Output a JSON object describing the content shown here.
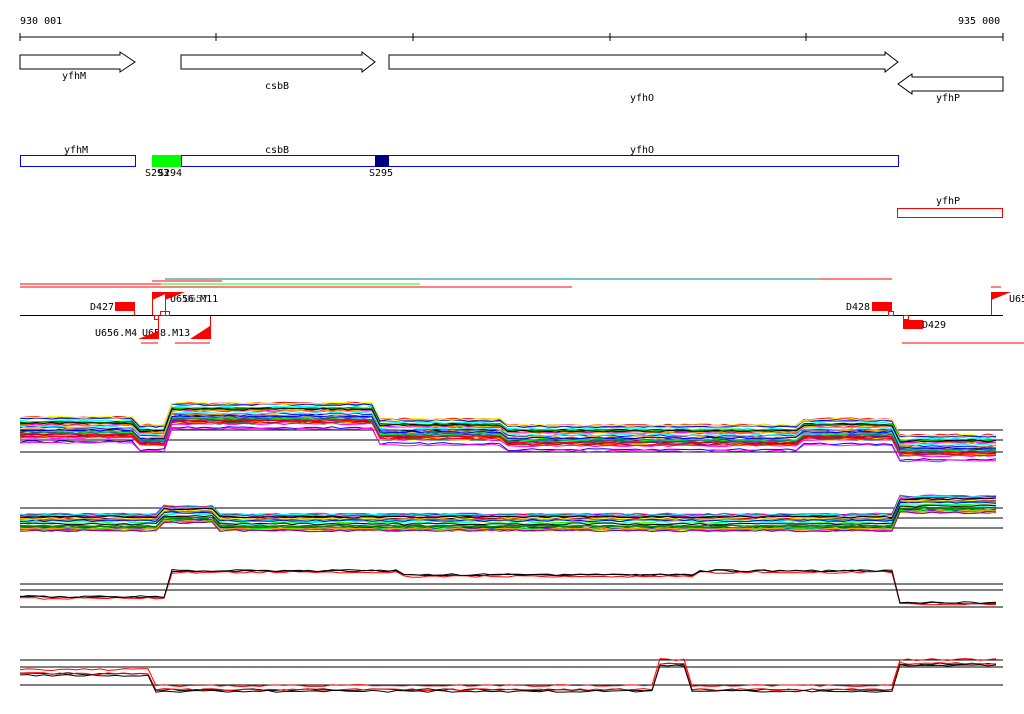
{
  "axis": {
    "start_label": "930 001",
    "end_label": "935 000"
  },
  "genes": [
    {
      "name": "yfhM",
      "strand": "+"
    },
    {
      "name": "csbB",
      "strand": "+"
    },
    {
      "name": "yfhO",
      "strand": "+"
    },
    {
      "name": "yfhP",
      "strand": "-"
    }
  ],
  "operons": {
    "yfhM": "yfhM",
    "csbB": "csbB",
    "yfhO": "yfhO",
    "yfhP": "yfhP"
  },
  "sites": {
    "s293": "S293",
    "s294": "S294",
    "s295": "S295"
  },
  "features": {
    "d427": "D427",
    "d428": "D428",
    "d429": "D429",
    "u656m4": "U656.M4",
    "u658m13": "U658.M13",
    "u656m11": "U656.M11",
    "u657": "U657",
    "u65": "U65"
  },
  "colors": {
    "blue": "#0000ff",
    "navy": "#000080",
    "green": "#00ff00",
    "red": "#ff0000"
  }
}
